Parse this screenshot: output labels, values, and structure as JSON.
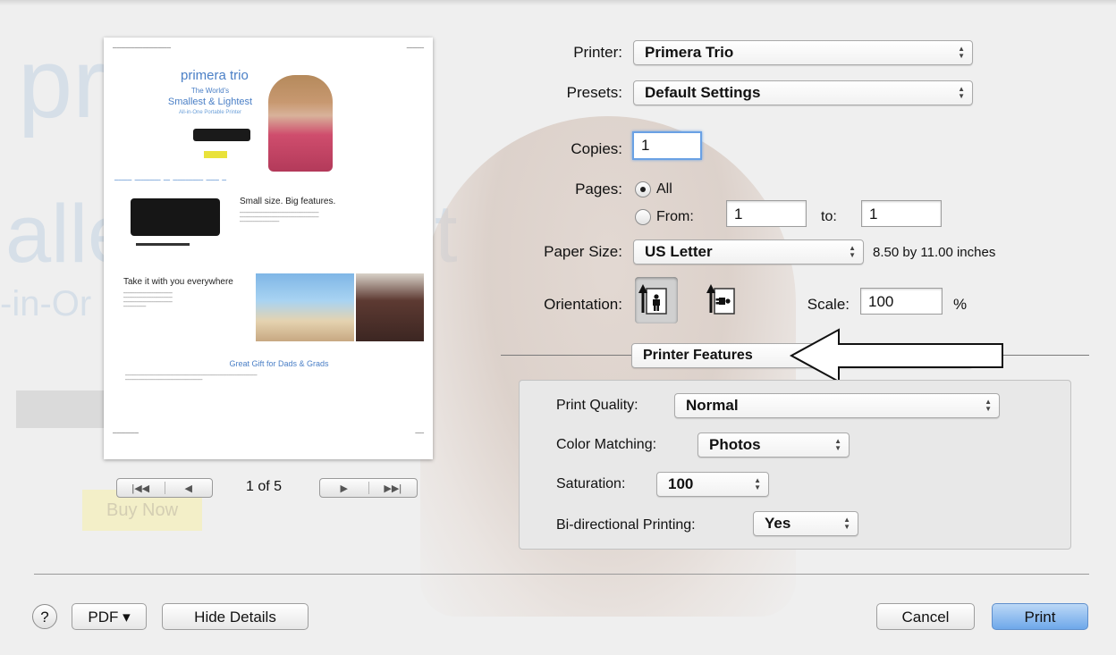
{
  "preview": {
    "page_text": {
      "brand": "primera trio",
      "tagline_1": "The World's",
      "tagline_2": "Smallest & Lightest",
      "tagline_3": "All-in-One Portable Printer",
      "heading_1": "Small size. Big features.",
      "heading_2": "Take it with you everywhere",
      "gift": "Great Gift for Dads & Grads"
    },
    "page_indicator": "1 of 5",
    "first_prev_glyphs": [
      "|◀◀",
      "◀"
    ],
    "next_last_glyphs": [
      "▶",
      "▶▶|"
    ]
  },
  "printer": {
    "label": "Printer:",
    "value": "Primera Trio"
  },
  "presets": {
    "label": "Presets:",
    "value": "Default Settings"
  },
  "copies": {
    "label": "Copies:",
    "value": "1"
  },
  "pages": {
    "label": "Pages:",
    "all_label": "All",
    "from_label": "From:",
    "from_value": "1",
    "to_label": "to:",
    "to_value": "1"
  },
  "paper_size": {
    "label": "Paper Size:",
    "value": "US Letter",
    "dimensions": "8.50 by 11.00 inches"
  },
  "orientation": {
    "label": "Orientation:",
    "selected": "portrait"
  },
  "scale": {
    "label": "Scale:",
    "value": "100",
    "unit": "%"
  },
  "section_popup": {
    "value": "Printer Features"
  },
  "features": {
    "print_quality": {
      "label": "Print Quality:",
      "value": "Normal"
    },
    "color_matching": {
      "label": "Color Matching:",
      "value": "Photos"
    },
    "saturation": {
      "label": "Saturation:",
      "value": "100"
    },
    "bidirectional": {
      "label": "Bi-directional Printing:",
      "value": "Yes"
    }
  },
  "footer": {
    "help": "?",
    "pdf": "PDF ▾",
    "hide_details": "Hide Details",
    "cancel": "Cancel",
    "print": "Print"
  },
  "background": {
    "words": [
      "pri",
      "T",
      "alle",
      "t",
      "-in-Or"
    ],
    "buy": "Buy Now"
  },
  "colors": {
    "accent": "#6ea8ea",
    "focus_ring": "#6aa1e4",
    "panel": "#e8e8e8"
  }
}
